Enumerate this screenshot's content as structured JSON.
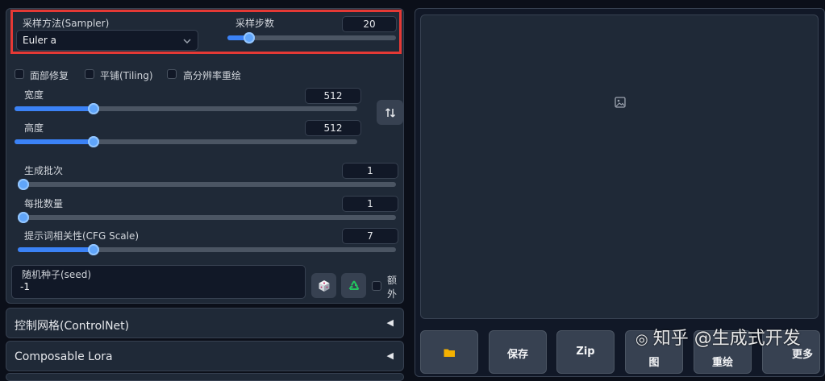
{
  "sampler": {
    "label": "采样方法(Sampler)",
    "value": "Euler a",
    "steps_label": "采样步数",
    "steps_value": "20",
    "steps_fraction": 0.13
  },
  "options": {
    "face_restore": "面部修复",
    "tiling": "平铺(Tiling)",
    "hires_fix": "高分辨率重绘"
  },
  "size": {
    "width_label": "宽度",
    "width_value": "512",
    "width_fraction": 0.23,
    "height_label": "高度",
    "height_value": "512",
    "height_fraction": 0.23,
    "swap_icon": "swap-arrows-icon"
  },
  "batch": {
    "count_label": "生成批次",
    "count_value": "1",
    "count_fraction": 0.0,
    "size_label": "每批数量",
    "size_value": "1",
    "size_fraction": 0.0
  },
  "cfg": {
    "label": "提示词相关性(CFG Scale)",
    "value": "7",
    "fraction": 0.2
  },
  "seed": {
    "label": "随机种子(seed)",
    "value": "-1",
    "dice_icon": "dice-icon",
    "recycle_icon": "recycle-icon",
    "extra_label": "额外"
  },
  "accordions": [
    {
      "title": "控制网格(ControlNet)"
    },
    {
      "title": "Composable Lora"
    }
  ],
  "output": {
    "image_icon": "image-icon"
  },
  "actions": {
    "folder_icon": "folder-icon",
    "save": "保存",
    "zip": "Zip",
    "send_img_partial": "图",
    "send_inpaint_partial": "重绘",
    "more_partial": "更多"
  },
  "watermark": {
    "text": "知乎 @生成式开发"
  },
  "colors": {
    "accent": "#3b82f6",
    "highlight_border": "#e53935",
    "bg": "#0b0f19",
    "panel": "#1f2937"
  }
}
